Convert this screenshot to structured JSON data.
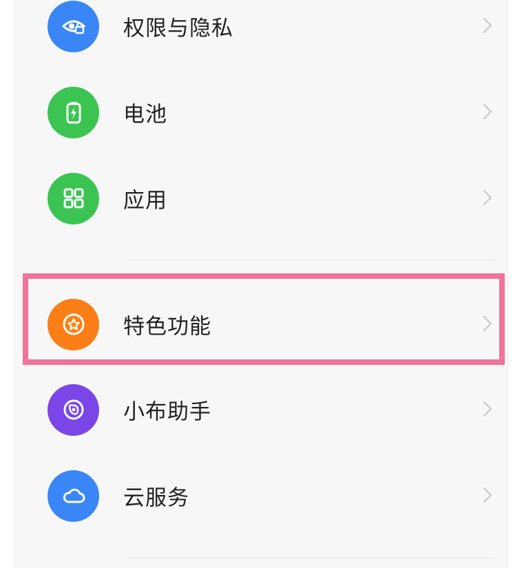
{
  "settings": {
    "items": [
      {
        "label": "权限与隐私",
        "icon": "eye-lock-icon",
        "color": "#3a86f6"
      },
      {
        "label": "电池",
        "icon": "battery-icon",
        "color": "#3cc452"
      },
      {
        "label": "应用",
        "icon": "apps-grid-icon",
        "color": "#3cc452"
      },
      {
        "label": "特色功能",
        "icon": "star-circle-icon",
        "color": "#fb7f16"
      },
      {
        "label": "小布助手",
        "icon": "assistant-icon",
        "color": "#7b46e8"
      },
      {
        "label": "云服务",
        "icon": "cloud-icon",
        "color": "#3a86f6"
      }
    ]
  },
  "highlight": {
    "color": "#f07399",
    "target": "特色功能"
  }
}
